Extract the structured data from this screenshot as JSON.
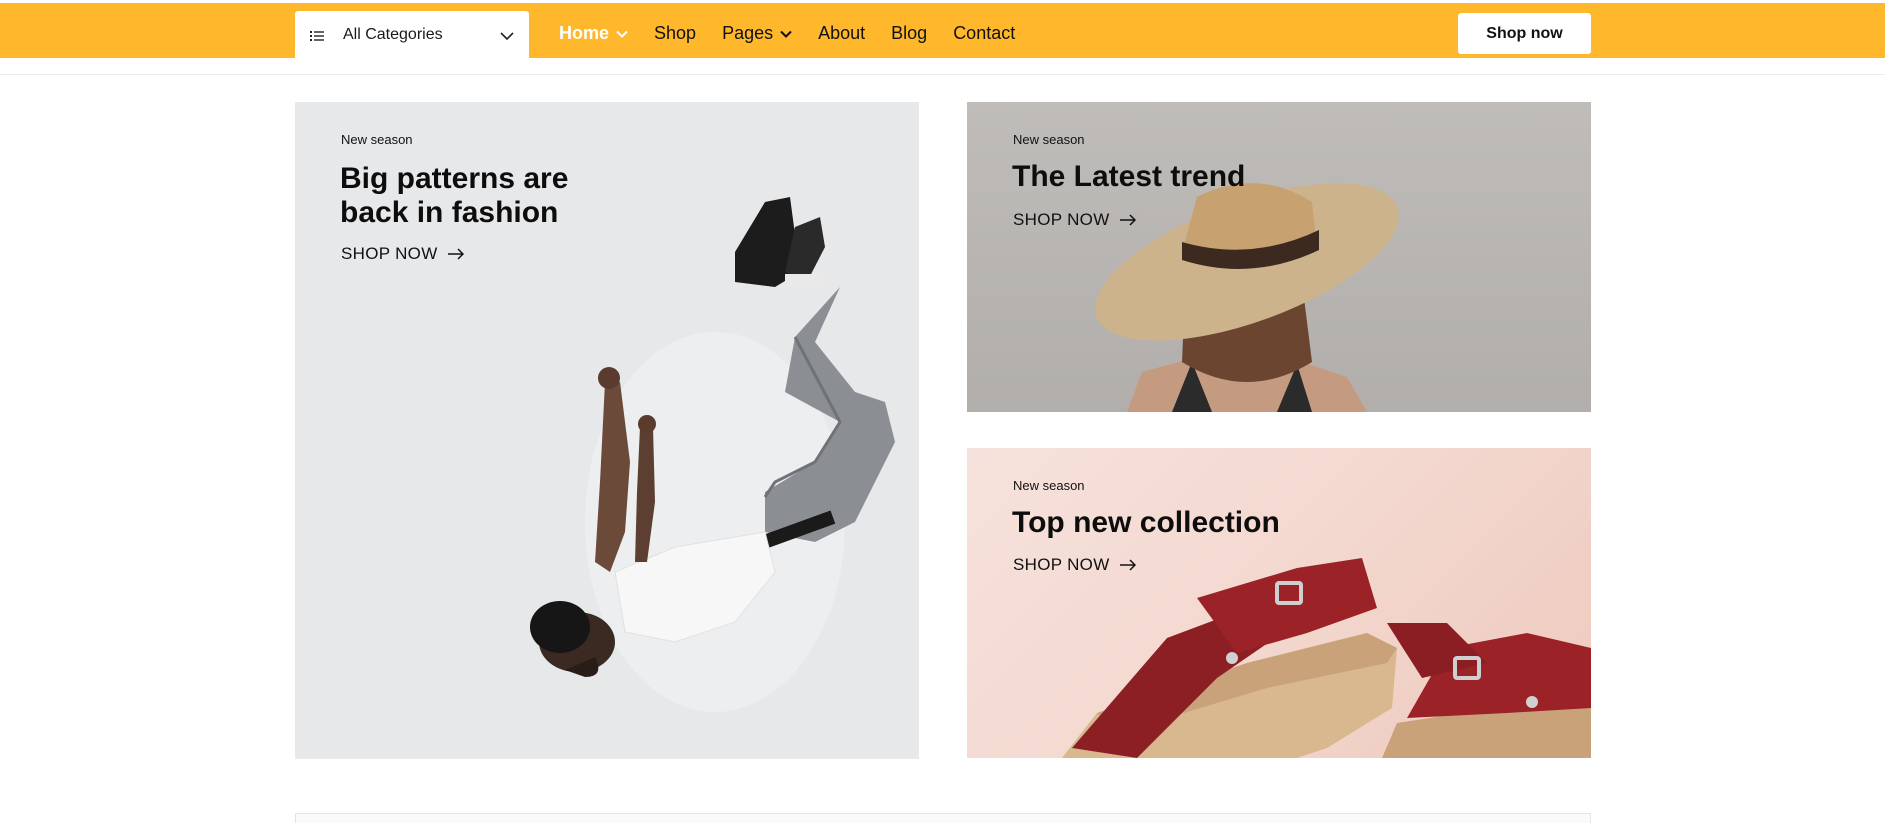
{
  "header": {
    "categories_label": "All Categories",
    "nav": [
      {
        "label": "Home",
        "has_dropdown": true,
        "active": true
      },
      {
        "label": "Shop",
        "has_dropdown": false,
        "active": false
      },
      {
        "label": "Pages",
        "has_dropdown": true,
        "active": false
      },
      {
        "label": "About",
        "has_dropdown": false,
        "active": false
      },
      {
        "label": "Blog",
        "has_dropdown": false,
        "active": false
      },
      {
        "label": "Contact",
        "has_dropdown": false,
        "active": false
      }
    ],
    "shop_button": "Shop now",
    "accent_color": "#ffb72b"
  },
  "banners": [
    {
      "eyebrow": "New season",
      "title_line1": "Big patterns are",
      "title_line2": "back in fashion",
      "cta": "SHOP NOW",
      "image": "man-jumping-photo"
    },
    {
      "eyebrow": "New season",
      "title": "The Latest trend",
      "cta": "SHOP NOW",
      "image": "woman-straw-hat-photo"
    },
    {
      "eyebrow": "New season",
      "title": "Top new collection",
      "cta": "SHOP NOW",
      "image": "red-sandals-photo"
    }
  ]
}
